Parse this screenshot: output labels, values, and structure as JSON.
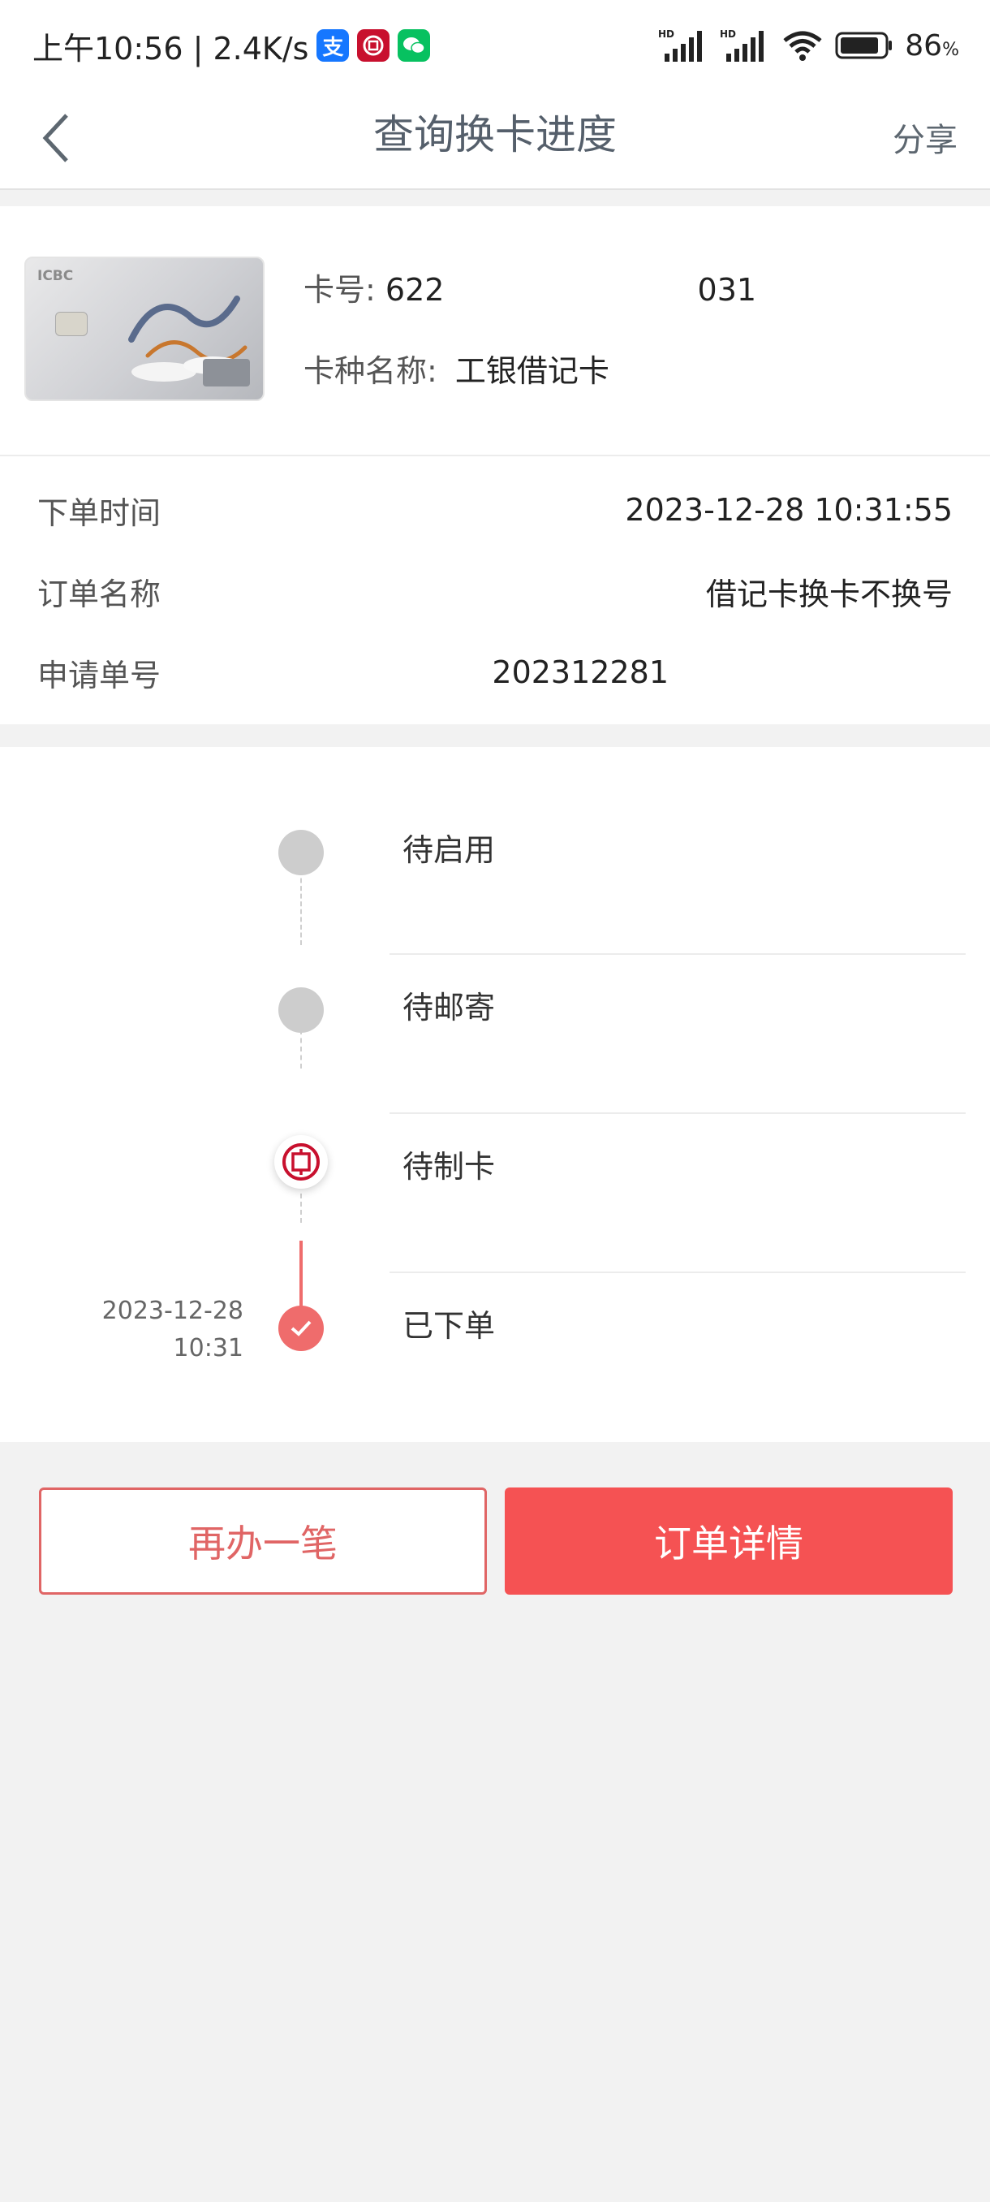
{
  "status_bar": {
    "time_speed": "上午10:56 | 2.4K/s",
    "battery": "86",
    "battery_unit": "%",
    "hd1": "HD",
    "hd2": "HD"
  },
  "nav": {
    "title": "查询换卡进度",
    "share": "分享"
  },
  "card": {
    "brand": "ICBC",
    "number_label": "卡号:",
    "number_start": "622",
    "number_end": "031",
    "type_label": "卡种名称:",
    "type_value": "工银借记卡"
  },
  "info": {
    "rows": [
      {
        "label": "下单时间",
        "value": "2023-12-28 10:31:55"
      },
      {
        "label": "订单名称",
        "value": "借记卡换卡不换号"
      },
      {
        "label": "申请单号",
        "value": "202312281"
      }
    ]
  },
  "timeline": {
    "steps": [
      {
        "label": "待启用",
        "state": "pending"
      },
      {
        "label": "待邮寄",
        "state": "pending"
      },
      {
        "label": "待制卡",
        "state": "current"
      },
      {
        "label": "已下单",
        "state": "done",
        "date": "2023-12-28",
        "time": "10:31"
      }
    ]
  },
  "buttons": {
    "again": "再办一笔",
    "detail": "订单详情"
  },
  "colors": {
    "accent": "#f55253",
    "done": "#ef6c6c",
    "pending": "#cdcdcd"
  }
}
